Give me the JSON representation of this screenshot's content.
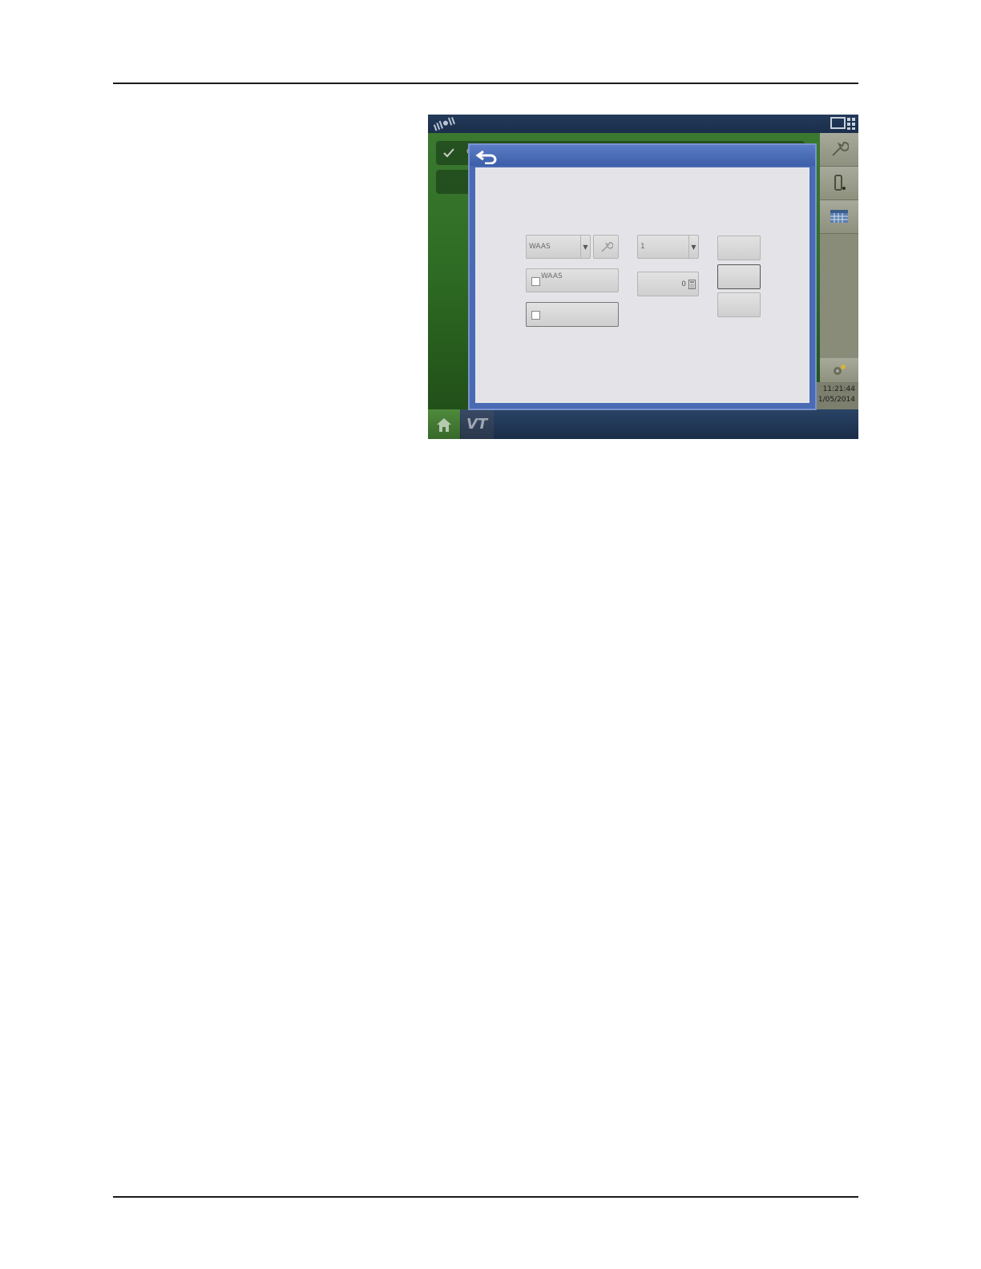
{
  "display": {
    "background_row": {
      "label": "G"
    },
    "gps_dropdown": {
      "value": "WAAS"
    },
    "channel_dropdown": {
      "value": "1"
    },
    "checkbox_waas": {
      "label": "WAAS"
    },
    "numeric_field": {
      "value": "0"
    },
    "clock": {
      "time": "11:21:44",
      "date": "1/05/2014"
    },
    "bottom_bar": {
      "vt_label": "VT"
    }
  },
  "colors": {
    "top_bar": "#1b2e4a",
    "dialog_frame": "#4a6ab4",
    "dialog_body": "#e4e4e8",
    "background_green": "#2f6d25"
  },
  "icons": [
    "gps-signal-icon",
    "layout-icon",
    "check-icon",
    "wrench-icon",
    "device-icon",
    "calendar-grid-icon",
    "settings-gear-icon",
    "home-icon",
    "back-icon",
    "calculator-icon"
  ]
}
